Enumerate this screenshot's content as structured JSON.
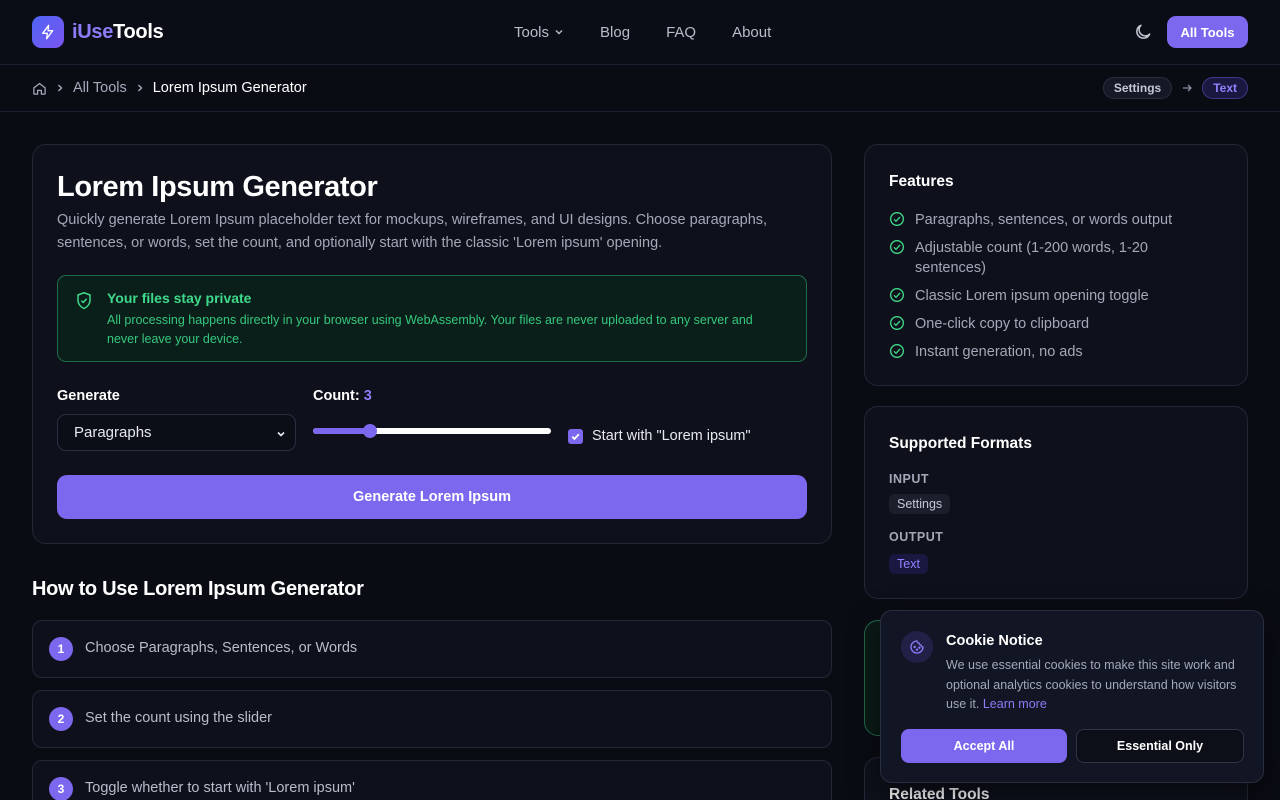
{
  "brand": {
    "name_a": "iUse",
    "name_b": "Tools"
  },
  "nav": {
    "tools": "Tools",
    "blog": "Blog",
    "faq": "FAQ",
    "about": "About",
    "all_tools": "All Tools"
  },
  "breadcrumb": {
    "all_tools": "All Tools",
    "current": "Lorem Ipsum Generator"
  },
  "flow": {
    "input": "Settings",
    "output": "Text"
  },
  "tool": {
    "title": "Lorem Ipsum Generator",
    "description": "Quickly generate Lorem Ipsum placeholder text for mockups, wireframes, and UI designs. Choose paragraphs, sentences, or words, set the count, and optionally start with the classic 'Lorem ipsum' opening.",
    "privacy_title": "Your files stay private",
    "privacy_text": "All processing happens directly in your browser using WebAssembly. Your files are never uploaded to any server and never leave your device.",
    "generate_label": "Generate",
    "generate_value": "Paragraphs",
    "count_label": "Count:",
    "count_value": 3,
    "count_fraction": 0.24,
    "checkbox_label": "Start with \"Lorem ipsum\"",
    "checkbox_checked": true,
    "button": "Generate Lorem Ipsum"
  },
  "howto": {
    "title": "How to Use Lorem Ipsum Generator",
    "steps": [
      {
        "n": "1",
        "text": "Choose Paragraphs, Sentences, or Words"
      },
      {
        "n": "2",
        "text": "Set the count using the slider"
      },
      {
        "n": "3",
        "text": "Toggle whether to start with 'Lorem ipsum'"
      }
    ]
  },
  "features": {
    "title": "Features",
    "items": [
      "Paragraphs, sentences, or words output",
      "Adjustable count (1-200 words, 1-20 sentences)",
      "Classic Lorem ipsum opening toggle",
      "One-click copy to clipboard",
      "Instant generation, no ads"
    ]
  },
  "formats": {
    "title": "Supported Formats",
    "input_label": "INPUT",
    "input_value": "Settings",
    "output_label": "OUTPUT",
    "output_value": "Text"
  },
  "related": {
    "title": "Related Tools"
  },
  "cookie": {
    "title": "Cookie Notice",
    "text": "We use essential cookies to make this site work and optional analytics cookies to understand how visitors use it.",
    "link": "Learn more",
    "accept": "Accept All",
    "essential": "Essential Only"
  },
  "colors": {
    "accent": "#7b68ee",
    "success": "#3ed98a",
    "background": "#0a0c14"
  }
}
